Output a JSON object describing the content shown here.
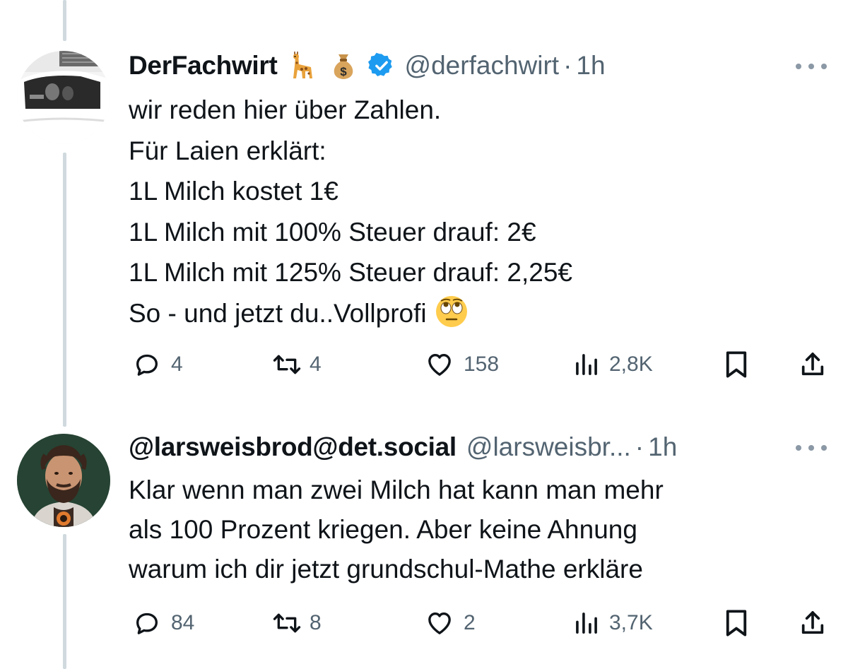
{
  "tweets": [
    {
      "display_name": "DerFachwirt",
      "badge_emojis": [
        "giraffe-emoji",
        "money-bag-emoji"
      ],
      "verified": true,
      "handle": "@derfachwirt",
      "separator": "·",
      "time": "1h",
      "text_lines": [
        "wir reden hier über Zahlen.",
        "Für Laien erklärt:",
        "1L Milch kostet 1€",
        "1L Milch mit 100% Steuer drauf: 2€",
        "1L Milch mit 125% Steuer drauf: 2,25€",
        "So - und jetzt du..Vollprofi"
      ],
      "trailing_emoji": "face-with-rolling-eyes-emoji",
      "stats": {
        "replies": "4",
        "reposts": "4",
        "likes": "158",
        "views": "2,8K"
      }
    },
    {
      "display_name": "@larsweisbrod@det.social",
      "handle": "@larsweisbr...",
      "separator": "·",
      "time": "1h",
      "text_lines": [
        "Klar wenn man zwei Milch hat kann man mehr",
        "als 100 Prozent kriegen. Aber keine Ahnung",
        "warum ich dir jetzt grundschul-Mathe erkläre"
      ],
      "stats": {
        "replies": "84",
        "reposts": "8",
        "likes": "2",
        "views": "3,7K"
      }
    }
  ],
  "colors": {
    "text": "#0f1419",
    "secondary": "#536471",
    "verified": "#1d9bf0",
    "thread_line": "#cfd9de"
  },
  "icons": [
    "reply-icon",
    "repost-icon",
    "like-icon",
    "views-icon",
    "bookmark-icon",
    "share-icon",
    "more-icon",
    "verified-badge-icon"
  ]
}
